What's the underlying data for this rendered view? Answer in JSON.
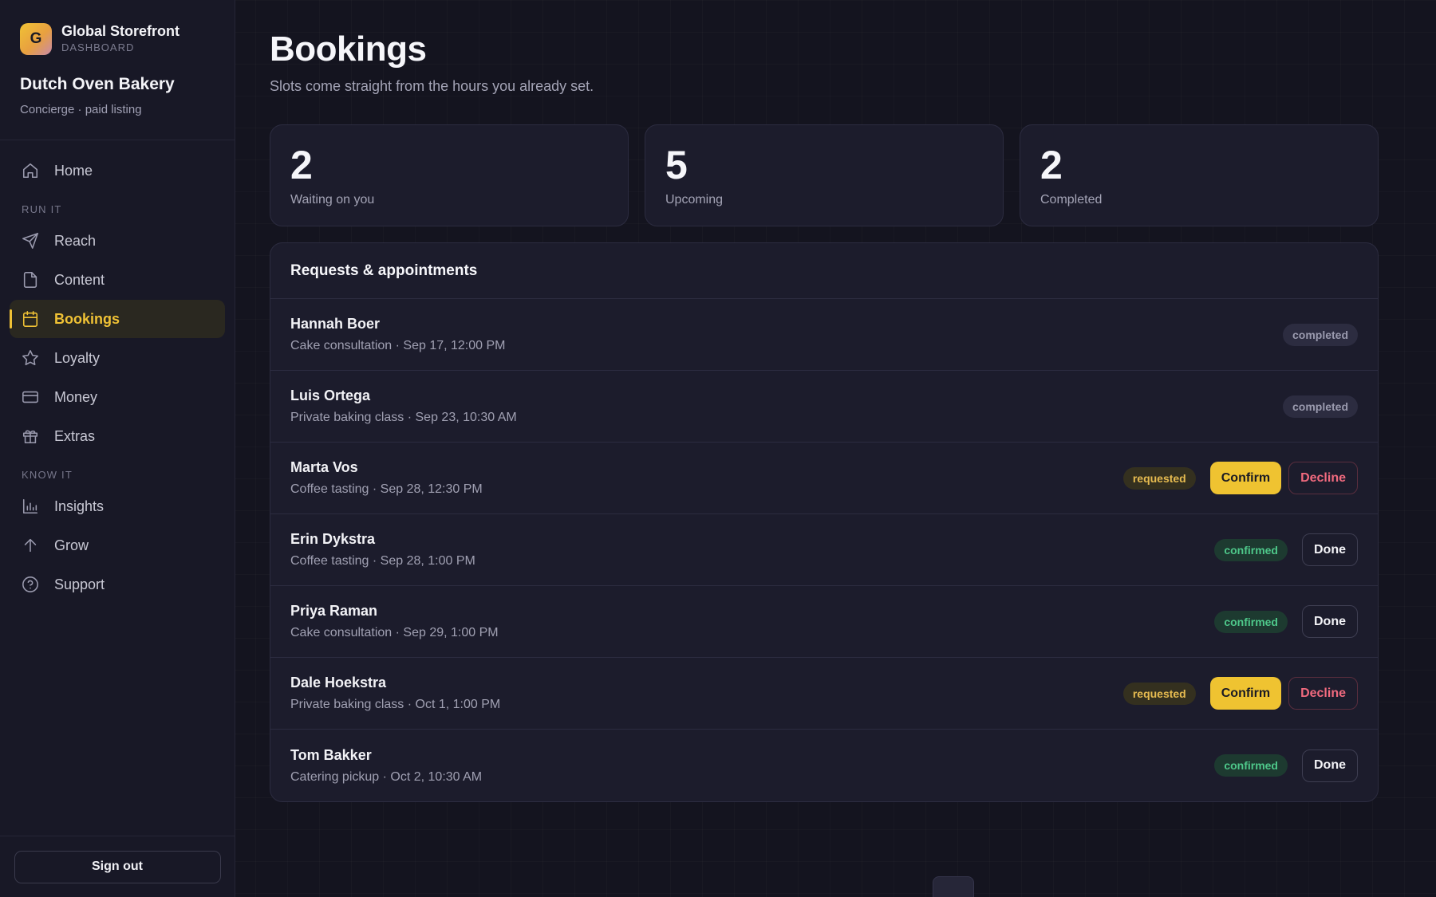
{
  "brand": {
    "logo_letter": "G",
    "name": "Global Storefront",
    "subtitle": "DASHBOARD"
  },
  "business": {
    "name": "Dutch Oven Bakery",
    "plan": "Concierge · paid listing"
  },
  "nav": {
    "home": "Home",
    "section_run": "RUN IT",
    "reach": "Reach",
    "content": "Content",
    "bookings": "Bookings",
    "loyalty": "Loyalty",
    "money": "Money",
    "extras": "Extras",
    "section_know": "KNOW IT",
    "insights": "Insights",
    "grow": "Grow",
    "support": "Support"
  },
  "signout_label": "Sign out",
  "page": {
    "title": "Bookings",
    "subtitle": "Slots come straight from the hours you already set."
  },
  "stats": [
    {
      "value": "2",
      "label": "Waiting on you"
    },
    {
      "value": "5",
      "label": "Upcoming"
    },
    {
      "value": "2",
      "label": "Completed"
    }
  ],
  "panel_title": "Requests & appointments",
  "bookings": [
    {
      "name": "Hannah Boer",
      "detail": "Cake consultation · Sep 17, 12:00 PM",
      "status": "completed"
    },
    {
      "name": "Luis Ortega",
      "detail": "Private baking class · Sep 23, 10:30 AM",
      "status": "completed"
    },
    {
      "name": "Marta Vos",
      "detail": "Coffee tasting · Sep 28, 12:30 PM",
      "status": "requested",
      "confirm": "Confirm",
      "decline": "Decline"
    },
    {
      "name": "Erin Dykstra",
      "detail": "Coffee tasting · Sep 28, 1:00 PM",
      "status": "confirmed",
      "done": "Done"
    },
    {
      "name": "Priya Raman",
      "detail": "Cake consultation · Sep 29, 1:00 PM",
      "status": "confirmed",
      "done": "Done"
    },
    {
      "name": "Dale Hoekstra",
      "detail": "Private baking class · Oct 1, 1:00 PM",
      "status": "requested",
      "confirm": "Confirm",
      "decline": "Decline"
    },
    {
      "name": "Tom Bakker",
      "detail": "Catering pickup · Oct 2, 10:30 AM",
      "status": "confirmed",
      "done": "Done"
    }
  ],
  "colors": {
    "accent": "#efc331",
    "completed": "#9a9aae",
    "requested": "#e6bb50",
    "confirmed": "#4ec88a",
    "decline": "#f06a7e"
  }
}
